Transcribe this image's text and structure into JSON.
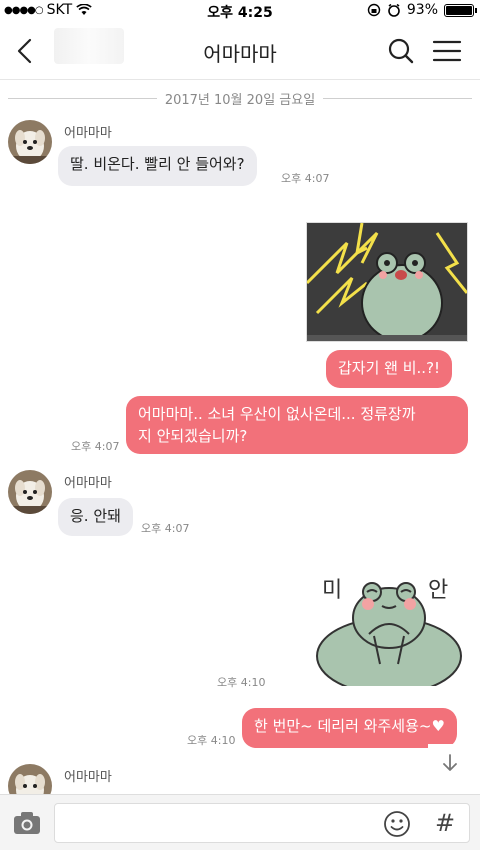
{
  "status_bar": {
    "signal": "●●●●○",
    "carrier": "SKT",
    "time": "오후 4:25",
    "battery_text": "93%",
    "battery_level": 0.93
  },
  "header": {
    "title": "어마마마"
  },
  "date_divider": "2017년 10월 20일 금요일",
  "messages": [
    {
      "sender": "어마마마",
      "text": "딸. 비온다. 빨리 안 들어와?",
      "time": "오후 4:07"
    },
    {
      "text": "갑자기 왠 비..?!"
    },
    {
      "text": "어마마마.. 소녀 우산이 없사온데... 정류장까지 안되겠습니까?",
      "line1": "어마마마.. 소녀 우산이 없사온데... 정류장까",
      "line2": "지 안되겠습니까?",
      "time": "오후 4:07"
    },
    {
      "sender": "어마마마",
      "text": "응. 안돼",
      "time": "오후 4:07"
    },
    {
      "sticker_left": "미",
      "sticker_right": "안",
      "time": "오후 4:10"
    },
    {
      "text": "한 번만~ 데리러 와주세용~♥",
      "time": "오후 4:10"
    },
    {
      "sender": "어마마마"
    }
  ],
  "colors": {
    "outgoing_bubble": "#f2717a",
    "incoming_bubble": "#ececf0",
    "frog": "#a9c4ae"
  },
  "icons": {
    "back": "chevron-left-icon",
    "search": "search-icon",
    "menu": "hamburger-menu-icon",
    "camera": "camera-icon",
    "emoji": "smiley-icon",
    "hash": "#",
    "scroll": "arrow-down-icon"
  }
}
